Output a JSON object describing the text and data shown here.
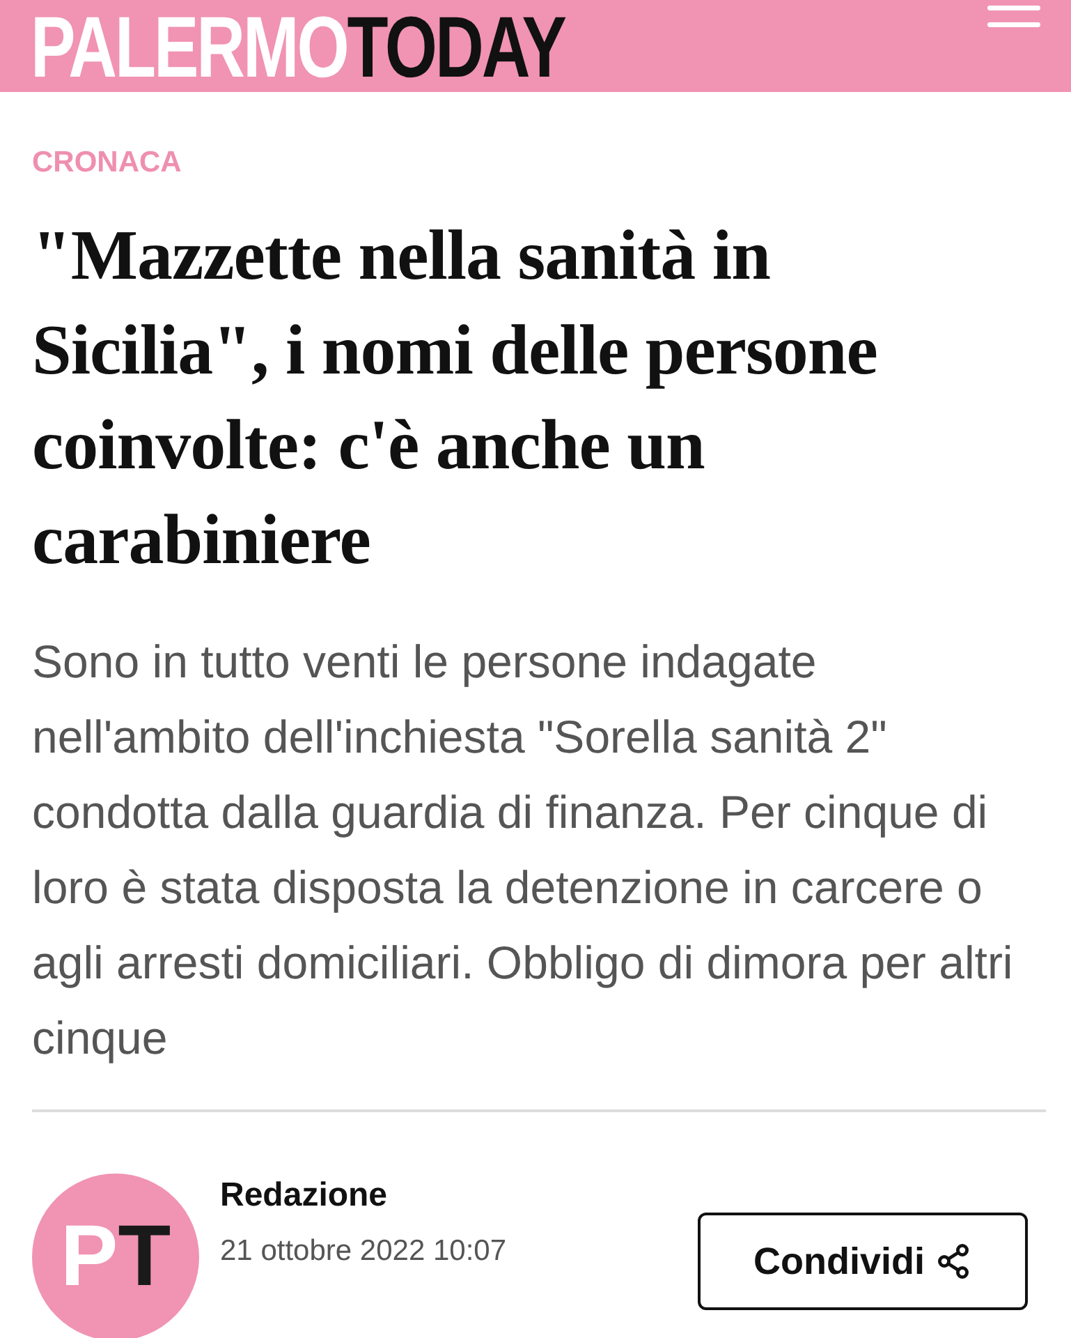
{
  "header": {
    "logo": {
      "first": "PALERMO",
      "second": "TODAY"
    }
  },
  "article": {
    "category": "CRONACA",
    "title": "\"Mazzette nella sanità in Sicilia\", i nomi delle persone coinvolte: c'è anche un carabiniere",
    "summary": "Sono in tutto venti le persone indagate nell'ambito dell'inchiesta \"Sorella sanità 2\" condotta dalla guardia di finanza. Per cinque di loro è stata disposta la detenzione in carcere o agli arresti domiciliari. Obbligo di dimora per altri cinque",
    "author": {
      "avatar": {
        "first": "P",
        "second": "T"
      },
      "name": "Redazione",
      "date": "21 ottobre 2022 10:07"
    },
    "share_button": "Condividi"
  }
}
